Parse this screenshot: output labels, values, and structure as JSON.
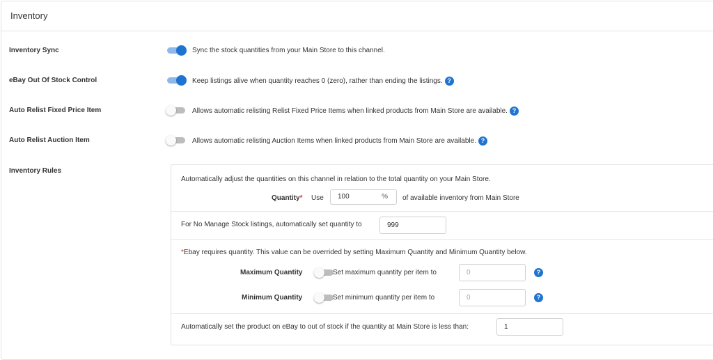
{
  "panel": {
    "title": "Inventory"
  },
  "settings": [
    {
      "label": "Inventory Sync",
      "enabled": true,
      "description": "Sync the stock quantities from your Main Store to this channel.",
      "help": false
    },
    {
      "label": "eBay Out Of Stock Control",
      "enabled": true,
      "description": "Keep listings alive when quantity reaches 0 (zero), rather than ending the listings.",
      "help": true
    },
    {
      "label": "Auto Relist Fixed Price Item",
      "enabled": false,
      "description": "Allows automatic relisting Relist Fixed Price Items when linked products from Main Store are available.",
      "help": true
    },
    {
      "label": "Auto Relist Auction Item",
      "enabled": false,
      "description": "Allows automatic relisting Auction Items when linked products from Main Store are available.",
      "help": true
    }
  ],
  "rules": {
    "label": "Inventory Rules",
    "intro": "Automatically adjust the quantities on this channel in relation to the total quantity on your Main Store.",
    "quantity": {
      "label": "Quantity",
      "required_mark": "*",
      "use_text": "Use",
      "value": "100",
      "unit": "%",
      "suffix_text": "of available inventory from Main Store"
    },
    "no_manage": {
      "text": "For No Manage Stock listings, automatically set quantity to",
      "value": "999"
    },
    "ebay_note": {
      "mark": "*",
      "text": "Ebay requires quantity. This value can be overrided by setting Maximum Quantity and Minimum Quantity below."
    },
    "max_quantity": {
      "label": "Maximum Quantity",
      "enabled": false,
      "text": "Set maximum quantity per item to",
      "placeholder": "0"
    },
    "min_quantity": {
      "label": "Minimum Quantity",
      "enabled": false,
      "text": "Set minimum quantity per item to",
      "placeholder": "0"
    },
    "out_of_stock": {
      "text": "Automatically set the product on eBay to out of stock if the quantity at Main Store is less than:",
      "value": "1"
    }
  },
  "help_icon": {
    "glyph": "?",
    "color": "#1f74d1"
  },
  "colors": {
    "toggle_on": "#1f74d1",
    "toggle_on_track": "#8fb8ea",
    "toggle_off_track": "#bdbdbd",
    "required": "#d9312e"
  }
}
